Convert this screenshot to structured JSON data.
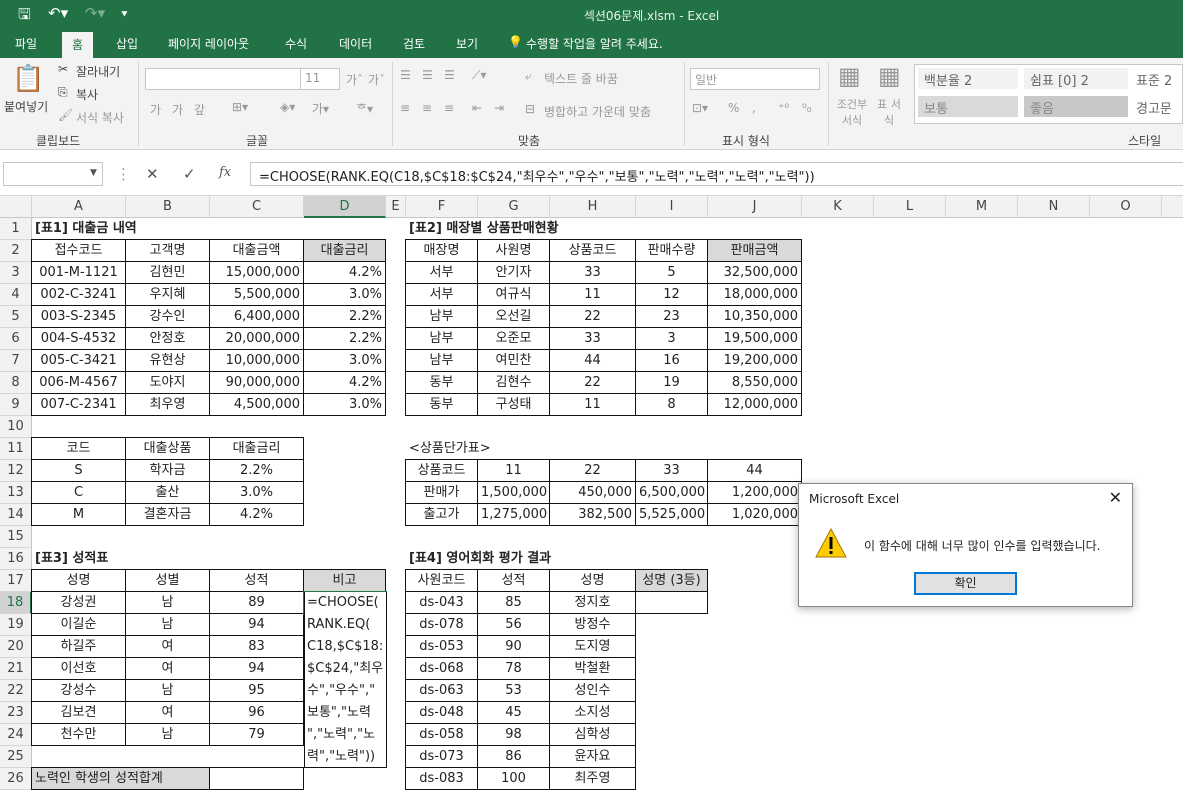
{
  "window": {
    "title": "섹션06문제.xlsm - Excel"
  },
  "tabs": [
    {
      "label": "파일"
    },
    {
      "label": "홈"
    },
    {
      "label": "삽입"
    },
    {
      "label": "페이지 레이아웃"
    },
    {
      "label": "수식"
    },
    {
      "label": "데이터"
    },
    {
      "label": "검토"
    },
    {
      "label": "보기"
    },
    {
      "label": "수행할 작업을 알려 주세요."
    }
  ],
  "ribbon": {
    "paste": "붙여넣기",
    "cut": "잘라내기",
    "copy": "복사",
    "format_painter": "서식 복사",
    "clipboard": "클립보드",
    "font_size": "11",
    "font_group": "글꼴",
    "wrap_text": "텍스트 줄 바꿈",
    "merge_center": "병합하고 가운데 맞춤",
    "align_group": "맞춤",
    "number_format": "일반",
    "number_group": "표시 형식",
    "cond_format": "조건부 서식",
    "table_format": "표 서식",
    "styles": [
      "백분율 2",
      "쉼표 [0] 2",
      "표준 2",
      "보통",
      "좋음",
      "경고문"
    ],
    "style_group": "스타일"
  },
  "formula_bar": {
    "name_box": "",
    "cancel": "✕",
    "enter": "✓",
    "fx": "fx",
    "formula": "=CHOOSE(RANK.EQ(C18,$C$18:$C$24,\"최우수\",\"우수\",\"보통\",\"노력\",\"노력\",\"노력\",\"노력\"))"
  },
  "columns": [
    "A",
    "B",
    "C",
    "D",
    "E",
    "F",
    "G",
    "H",
    "I",
    "J",
    "K",
    "L",
    "M",
    "N",
    "O"
  ],
  "rows": [
    "1",
    "2",
    "3",
    "4",
    "5",
    "6",
    "7",
    "8",
    "9",
    "10",
    "11",
    "12",
    "13",
    "14",
    "15",
    "16",
    "17",
    "18",
    "19",
    "20",
    "21",
    "22",
    "23",
    "24",
    "25",
    "26"
  ],
  "sheet": {
    "t1_title": "[표1] 대출금 내역",
    "t1_headers": [
      "접수코드",
      "고객명",
      "대출금액",
      "대출금리"
    ],
    "t1_rows": [
      [
        "001-M-1121",
        "김현민",
        "15,000,000",
        "4.2%"
      ],
      [
        "002-C-3241",
        "우지혜",
        "5,500,000",
        "3.0%"
      ],
      [
        "003-S-2345",
        "강수인",
        "6,400,000",
        "2.2%"
      ],
      [
        "004-S-4532",
        "안정호",
        "20,000,000",
        "2.2%"
      ],
      [
        "005-C-3421",
        "유현상",
        "10,000,000",
        "3.0%"
      ],
      [
        "006-M-4567",
        "도야지",
        "90,000,000",
        "4.2%"
      ],
      [
        "007-C-2341",
        "최우영",
        "4,500,000",
        "3.0%"
      ]
    ],
    "lookup_headers": [
      "코드",
      "대출상품",
      "대출금리"
    ],
    "lookup_rows": [
      [
        "S",
        "학자금",
        "2.2%"
      ],
      [
        "C",
        "출산",
        "3.0%"
      ],
      [
        "M",
        "결혼자금",
        "4.2%"
      ]
    ],
    "t2_title": "[표2] 매장별 상품판매현황",
    "t2_headers": [
      "매장명",
      "사원명",
      "상품코드",
      "판매수량",
      "판매금액"
    ],
    "t2_rows": [
      [
        "서부",
        "안기자",
        "33",
        "5",
        "32,500,000"
      ],
      [
        "서부",
        "여규식",
        "11",
        "12",
        "18,000,000"
      ],
      [
        "남부",
        "오선길",
        "22",
        "23",
        "10,350,000"
      ],
      [
        "남부",
        "오준모",
        "33",
        "3",
        "19,500,000"
      ],
      [
        "남부",
        "여민찬",
        "44",
        "16",
        "19,200,000"
      ],
      [
        "동부",
        "김현수",
        "22",
        "19",
        "8,550,000"
      ],
      [
        "동부",
        "구성태",
        "11",
        "8",
        "12,000,000"
      ]
    ],
    "price_title": "<상품단가표>",
    "price_rows": [
      [
        "상품코드",
        "11",
        "22",
        "33",
        "44"
      ],
      [
        "판매가",
        "1,500,000",
        "450,000",
        "6,500,000",
        "1,200,000"
      ],
      [
        "출고가",
        "1,275,000",
        "382,500",
        "5,525,000",
        "1,020,000"
      ]
    ],
    "t3_title": "[표3] 성적표",
    "t3_headers": [
      "성명",
      "성별",
      "성적",
      "비고"
    ],
    "t3_rows": [
      [
        "강성권",
        "남",
        "89"
      ],
      [
        "이길순",
        "남",
        "94"
      ],
      [
        "하길주",
        "여",
        "83"
      ],
      [
        "이선호",
        "여",
        "94"
      ],
      [
        "강성수",
        "남",
        "95"
      ],
      [
        "김보견",
        "여",
        "96"
      ],
      [
        "천수만",
        "남",
        "79"
      ]
    ],
    "t3_footer": "노력인 학생의 성적합계",
    "d18_text": "=CHOOSE(\nRANK.EQ(\nC18,$C$18:\n$C$24,\"최우\n수\",\"우수\",\"\n보통\",\"노력\n\",\"노력\",\"노\n력\",\"노력\"))",
    "t4_title": "[표4] 영어회화 평가 결과",
    "t4_headers": [
      "사원코드",
      "성적",
      "성명",
      "성명 (3등)"
    ],
    "t4_rows": [
      [
        "ds-043",
        "85",
        "정지호"
      ],
      [
        "ds-078",
        "56",
        "방정수"
      ],
      [
        "ds-053",
        "90",
        "도지영"
      ],
      [
        "ds-068",
        "78",
        "박철환"
      ],
      [
        "ds-063",
        "53",
        "성인수"
      ],
      [
        "ds-048",
        "45",
        "소지성"
      ],
      [
        "ds-058",
        "98",
        "심학성"
      ],
      [
        "ds-073",
        "86",
        "윤자요"
      ],
      [
        "ds-083",
        "100",
        "최주영"
      ]
    ]
  },
  "dialog": {
    "title": "Microsoft Excel",
    "message": "이 함수에 대해 너무 많이 인수를 입력했습니다.",
    "ok": "확인",
    "close": "✕"
  },
  "colors": {
    "excel_green": "#217346",
    "header_gray": "#d9d9d9"
  }
}
